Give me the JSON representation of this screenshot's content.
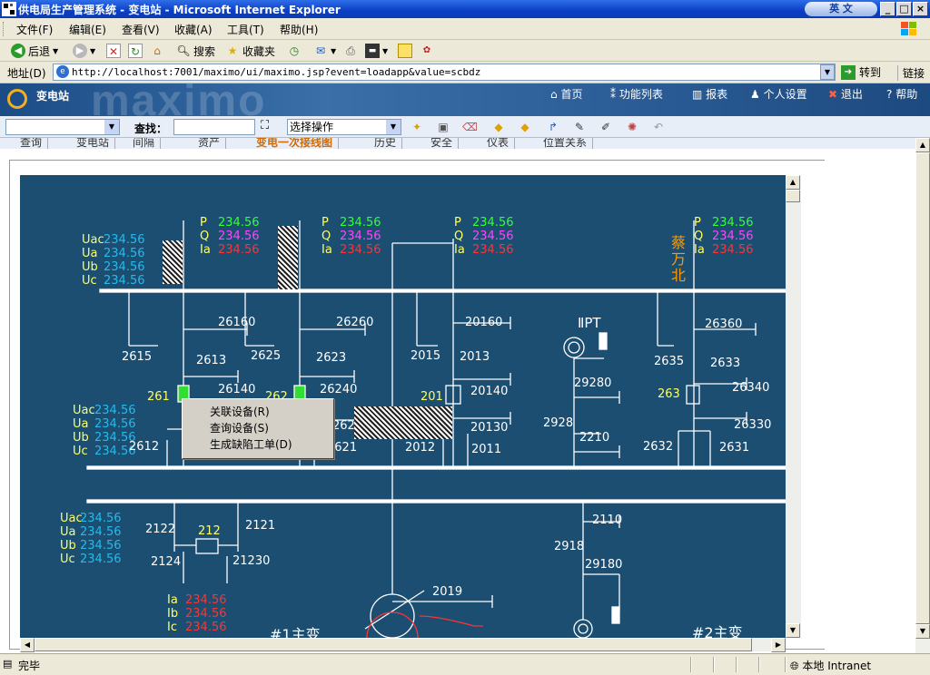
{
  "window": {
    "title": "供电局生产管理系统 - 变电站 - Microsoft Internet Explorer",
    "ime_label": "英 文",
    "buttons": {
      "minimize": "_",
      "maximize": "□",
      "close": "×"
    }
  },
  "menu": {
    "items": [
      "文件(F)",
      "编辑(E)",
      "查看(V)",
      "收藏(A)",
      "工具(T)",
      "帮助(H)"
    ]
  },
  "toolbar": {
    "back": "后退",
    "search": "搜索",
    "favorites": "收藏夹"
  },
  "address": {
    "label": "地址(D)",
    "url": "http://localhost:7001/maximo/ui/maximo.jsp?event=loadapp&value=scbdz",
    "go": "转到",
    "links": "链接"
  },
  "header": {
    "app_title": "变电站",
    "watermark": "maximo",
    "links": [
      "首页",
      "功能列表",
      "报表",
      "个人设置",
      "退出",
      "帮助"
    ]
  },
  "mx_toolbar": {
    "find_label": "查找：",
    "find_value": "",
    "action_select": "选择操作"
  },
  "tabs": {
    "items": [
      "查询",
      "变电站",
      "间隔",
      "资产",
      "变电一次接线图",
      "历史",
      "安全",
      "仪表",
      "位置关系"
    ],
    "active_index": 4
  },
  "diagram": {
    "colors": {
      "bg": "#1c4e72",
      "line": "#ffffff",
      "label": "#ffff66",
      "p": "#33ff33",
      "q": "#ff44ff",
      "ia": "#ff3333",
      "volt": "#22bbee",
      "orange": "#ff9900"
    },
    "measure_value": "234.56",
    "volt_labels": [
      "Uac",
      "Ua",
      "Ub",
      "Uc"
    ],
    "pqi_labels": [
      "P",
      "Q",
      "Ia"
    ],
    "current_labels": [
      "Ia",
      "Ib",
      "Ic"
    ],
    "station_name": "蔡万北",
    "pt_label": "ⅡPT",
    "transformer1": "#1主变",
    "transformer2": "#2主变",
    "nodes": [
      "26160",
      "2615",
      "2613",
      "26140",
      "261",
      "2612",
      "26260",
      "2625",
      "2623",
      "26240",
      "262",
      "2621",
      "20160",
      "2015",
      "2013",
      "201",
      "20140",
      "20130",
      "2012",
      "2011",
      "29280",
      "2928",
      "2210",
      "26360",
      "2635",
      "2633",
      "26340",
      "263",
      "26330",
      "2632",
      "2631",
      "2122",
      "212",
      "2121",
      "2124",
      "21230",
      "2110",
      "2918",
      "29180",
      "2019",
      "2628"
    ]
  },
  "context_menu": {
    "items": [
      "关联设备(R)",
      "查询设备(S)",
      "生成缺陷工单(D)"
    ]
  },
  "status": {
    "text": "完毕",
    "zone": "本地 Intranet"
  }
}
